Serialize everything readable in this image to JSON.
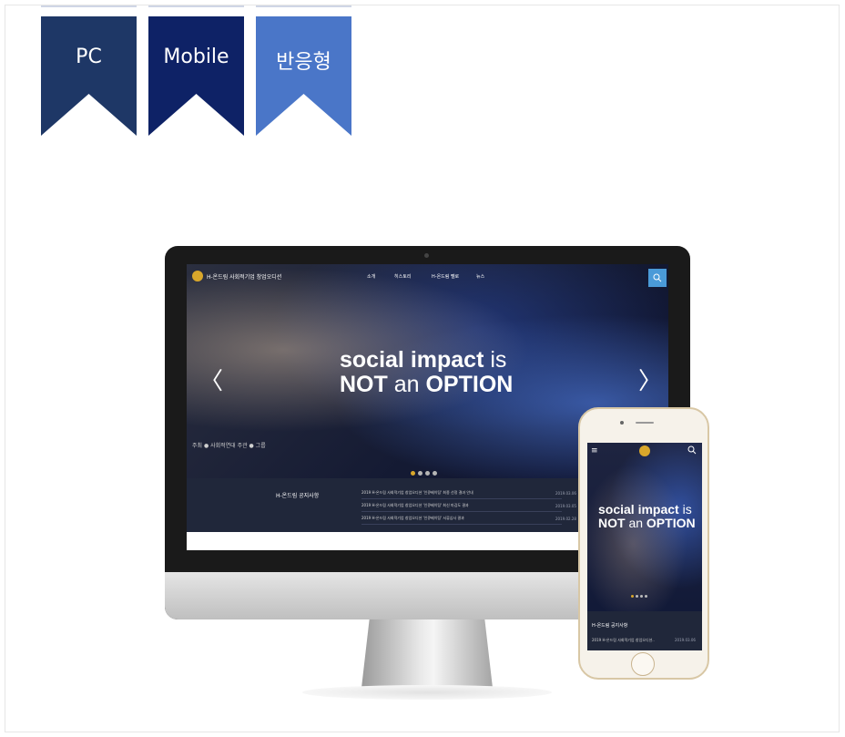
{
  "tabs": [
    {
      "label": "PC",
      "color": "#1e3766"
    },
    {
      "label": "Mobile",
      "color": "#0e2266"
    },
    {
      "label": "반응형",
      "color": "#4a76c8"
    }
  ],
  "desktop": {
    "site_name": "H-온드림 사회적기업 창업오디션",
    "nav": [
      "소개",
      "히스토리",
      "H-온드림 펠로",
      "뉴스"
    ],
    "hero": {
      "line1_bold": "social impact",
      "line1_light": " is",
      "line2_bold1": "NOT",
      "line2_light": " an ",
      "line2_bold2": "OPTION"
    },
    "prev_arrow": "〈",
    "next_arrow": "〉",
    "sponsors": "주최  ● 사회적연대  주관  ● 그룹     ",
    "notice": {
      "title": "H-온드림 공지사항",
      "rows": [
        {
          "text": "2019 H-온드림 사회적기업 창업오디션 '인큐베이팅' 최종 선정 결과 안내",
          "date": "2019.03.06"
        },
        {
          "text": "2019 H-온드림 사회적기업 창업오디션 '인큐베이팅' 최신 마감도 결과",
          "date": "2019.03.05"
        },
        {
          "text": "2019 H-온드림 사회적기업 창업오디션 '인큐베이팅' 서류심사 결과",
          "date": "2019.02.28"
        }
      ]
    }
  },
  "mobile": {
    "menu_icon": "≡",
    "hero": {
      "line1_bold": "social impact",
      "line1_light": " is",
      "line2_bold1": "NOT",
      "line2_light": " an ",
      "line2_bold2": "OPTION"
    },
    "notice_title": "H-온드림 공지사항",
    "notice_row": "2019 H-온드림 사회적기업 창업오디션..",
    "notice_date": "2019.03.06"
  }
}
